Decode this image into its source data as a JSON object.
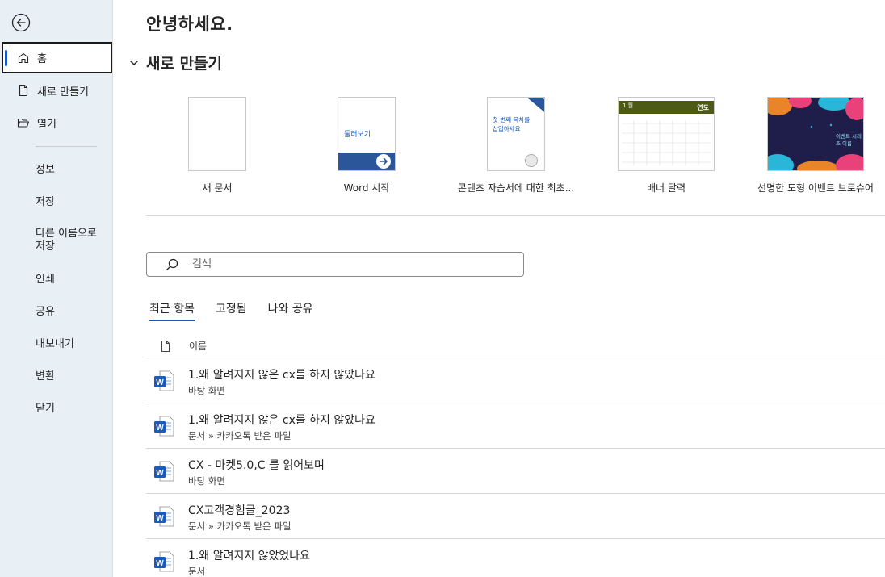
{
  "sidebar": {
    "back_icon": "back-arrow-icon",
    "items": [
      {
        "label": "홈",
        "icon": "home-icon"
      },
      {
        "label": "새로 만들기",
        "icon": "new-document-icon"
      },
      {
        "label": "열기",
        "icon": "open-folder-icon"
      },
      {
        "label": "정보"
      },
      {
        "label": "저장"
      },
      {
        "label": "다른 이름으로 저장"
      },
      {
        "label": "인쇄"
      },
      {
        "label": "공유"
      },
      {
        "label": "내보내기"
      },
      {
        "label": "변환"
      },
      {
        "label": "닫기"
      }
    ]
  },
  "main": {
    "greeting": "안녕하세요.",
    "new_section": {
      "title": "새로 만들기",
      "templates": [
        {
          "caption": "새 문서"
        },
        {
          "caption": "Word 시작",
          "thumb_text": "둘러보기"
        },
        {
          "caption": "콘텐츠 자습서에 대한 최초...",
          "thumb_text": "첫 번째 목차를 삽입하세요"
        },
        {
          "caption": "배너 달력",
          "thumb_month": "1 월",
          "thumb_year": "연도"
        },
        {
          "caption": "선명한 도형 이벤트 브로슈어",
          "thumb_text": "이벤트 시리즈 이름"
        }
      ]
    },
    "search": {
      "placeholder": "검색"
    },
    "tabs": [
      "최근 항목",
      "고정됨",
      "나와 공유"
    ],
    "list": {
      "header_name": "이름",
      "rows": [
        {
          "name": "1.왜 알려지지 않은 cx를 하지 않았나요",
          "location": "바탕 화면"
        },
        {
          "name": "1.왜 알려지지 않은 cx를 하지 않았나요",
          "location": "문서 » 카카오톡 받은 파일"
        },
        {
          "name": "CX - 마켓5.0,C 를 읽어보며",
          "location": "바탕 화면"
        },
        {
          "name": "CX고객경험글_2023",
          "location": "문서 » 카카오톡 받은 파일"
        },
        {
          "name": "1.왜 알려지지 않았었나요",
          "location": "문서"
        }
      ]
    }
  },
  "colors": {
    "accent": "#185abd",
    "sidebar_bg": "#e8f0f5",
    "word_blue": "#185abd"
  }
}
